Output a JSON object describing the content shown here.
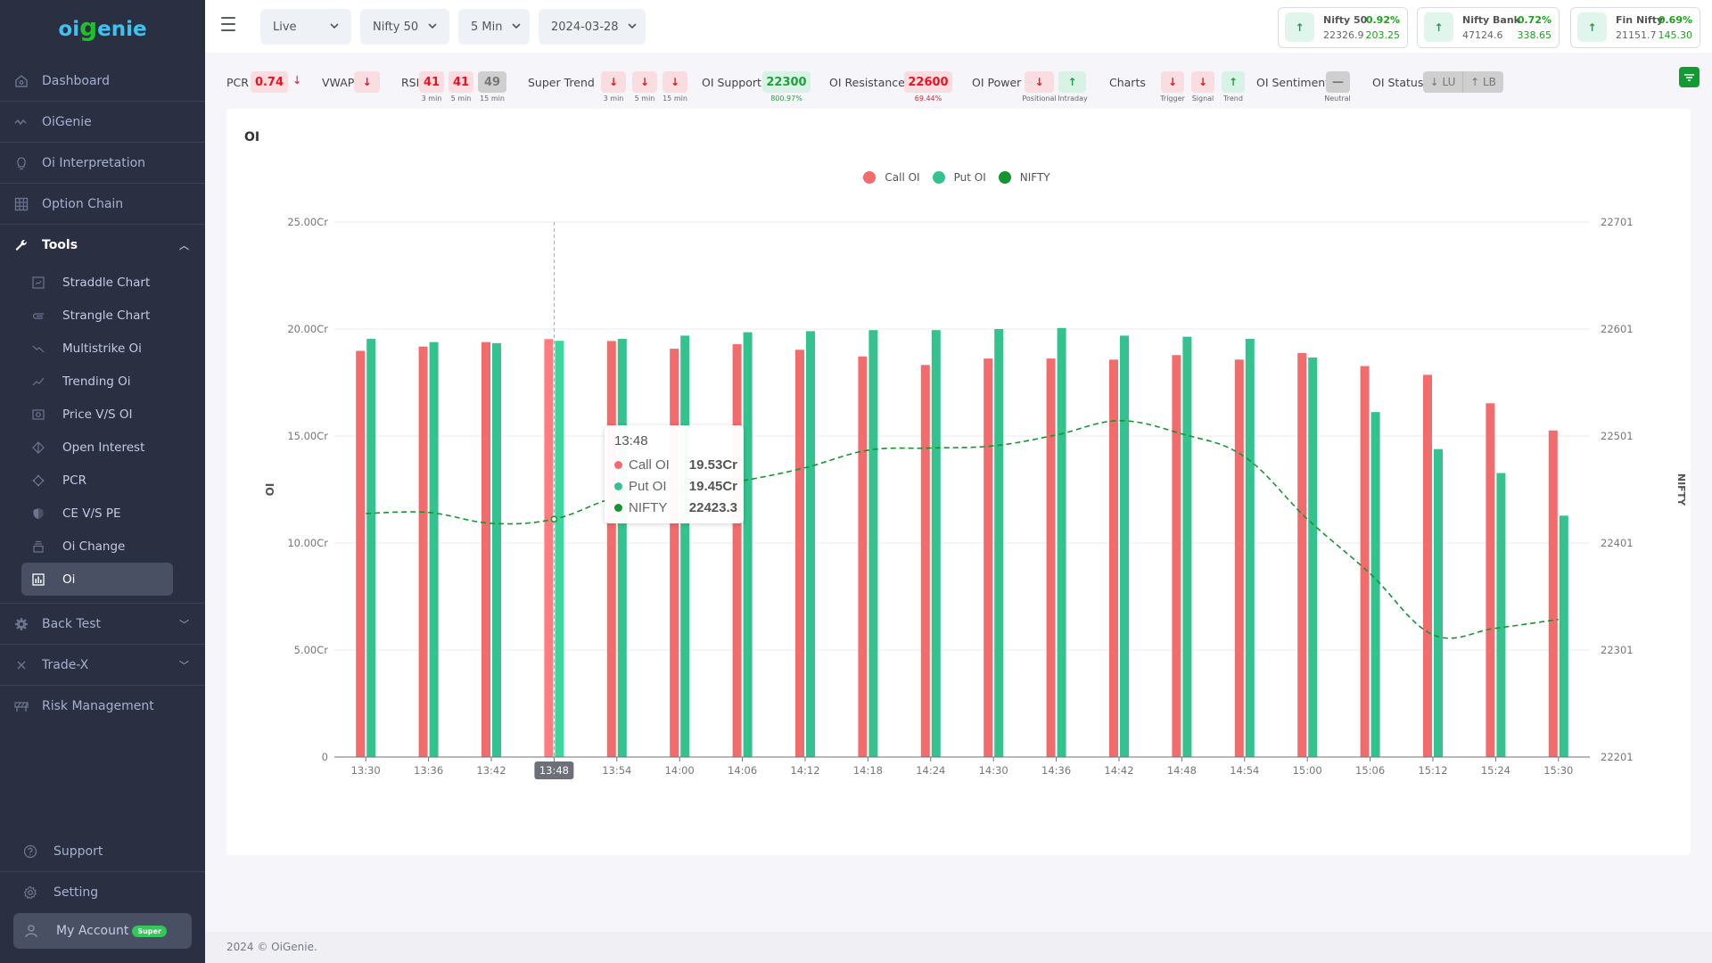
{
  "app": {
    "logo_oi": "oi",
    "logo_g": "g",
    "logo_rest": "enie"
  },
  "sidebar": {
    "items": [
      {
        "label": "Dashboard",
        "icon": "home-icon"
      },
      {
        "label": "OiGenie",
        "icon": "wave-icon"
      },
      {
        "label": "Oi Interpretation",
        "icon": "lightbulb-icon"
      },
      {
        "label": "Option Chain",
        "icon": "grid-icon"
      }
    ],
    "tools": {
      "label": "Tools",
      "expanded": true,
      "sub_items": [
        {
          "label": "Straddle Chart",
          "icon": "chart-box-icon"
        },
        {
          "label": "Strangle Chart",
          "icon": "paperclip-icon"
        },
        {
          "label": "Multistrike Oi",
          "icon": "trend-down-icon"
        },
        {
          "label": "Trending Oi",
          "icon": "trend-up-icon"
        },
        {
          "label": "Price V/S OI",
          "icon": "camera-box-icon"
        },
        {
          "label": "Open Interest",
          "icon": "diamond-icon"
        },
        {
          "label": "PCR",
          "icon": "ring-icon"
        },
        {
          "label": "CE V/S PE",
          "icon": "shield-icon"
        },
        {
          "label": "Oi Change",
          "icon": "layers-icon"
        },
        {
          "label": "Oi",
          "icon": "bar-chart-icon",
          "active": true
        }
      ]
    },
    "after_tools": [
      {
        "label": "Back Test",
        "icon": "gear-icon",
        "has_chevron": true
      },
      {
        "label": "Trade-X",
        "icon": "x-icon",
        "has_chevron": true
      },
      {
        "label": "Risk Management",
        "icon": "barrier-icon"
      }
    ],
    "bottom": [
      {
        "label": "Support",
        "icon": "help-circle-icon"
      },
      {
        "label": "Setting",
        "icon": "settings-icon"
      }
    ],
    "account": {
      "label": "My Account",
      "badge": "Super",
      "icon": "user-icon"
    }
  },
  "topbar": {
    "selects": [
      {
        "name": "mode",
        "value": "Live"
      },
      {
        "name": "index",
        "value": "Nifty 50"
      },
      {
        "name": "interval",
        "value": "5 Min"
      },
      {
        "name": "date",
        "value": "2024-03-28"
      }
    ],
    "tickers": [
      {
        "name": "Nifty 50",
        "price": "22326.9",
        "pct": "0.92%",
        "change": "203.25",
        "direction": "up"
      },
      {
        "name": "Nifty Bank",
        "price": "47124.6",
        "pct": "0.72%",
        "change": "338.65",
        "direction": "up"
      },
      {
        "name": "Fin Nifty",
        "price": "21151.7",
        "pct": "0.69%",
        "change": "145.30",
        "direction": "up"
      }
    ]
  },
  "indicators": {
    "pcr": {
      "label": "PCR",
      "value": "0.74",
      "arrow": "↓"
    },
    "vwap": {
      "label": "VWAP",
      "arrow": "↓"
    },
    "rsi": {
      "label": "RSI",
      "values": [
        "41",
        "41",
        "49"
      ],
      "captions": [
        "3 min",
        "5 min",
        "15 min"
      ]
    },
    "super_trend": {
      "label": "Super Trend",
      "arrows": [
        "↓",
        "↓",
        "↓"
      ],
      "captions": [
        "3 min",
        "5 min",
        "15 min"
      ]
    },
    "oi_support": {
      "label": "OI Support",
      "value": "22300",
      "caption": "800.97%"
    },
    "oi_resistance": {
      "label": "OI Resistance",
      "value": "22600",
      "caption": "69.44%"
    },
    "oi_power": {
      "label": "OI Power",
      "arrows": [
        "↓",
        "↑"
      ],
      "captions": [
        "Positional",
        "Intraday"
      ]
    },
    "charts": {
      "label": "Charts",
      "arrows": [
        "↓",
        "↓",
        "↑"
      ],
      "captions": [
        "Trigger",
        "Signal",
        "Trend"
      ]
    },
    "oi_sentiment": {
      "label": "OI Sentiment",
      "value": "—",
      "caption": "Neutral"
    },
    "oi_status": {
      "label": "OI Status",
      "values": [
        "↓ LU",
        "↑ LB"
      ]
    }
  },
  "card": {
    "title": "OI"
  },
  "tooltip": {
    "time": "13:48",
    "rows": [
      {
        "name": "Call OI",
        "value": "19.53Cr"
      },
      {
        "name": "Put OI",
        "value": "19.45Cr"
      },
      {
        "name": "NIFTY",
        "value": "22423.3"
      }
    ]
  },
  "footer": {
    "text": "2024 © OiGenie."
  },
  "chart_data": {
    "type": "bar",
    "title": "OI",
    "xlabel": "",
    "ylabel": "OI",
    "y2label": "NIFTY",
    "categories": [
      "13:30",
      "13:36",
      "13:42",
      "13:48",
      "13:54",
      "14:00",
      "14:06",
      "14:12",
      "14:18",
      "14:24",
      "14:30",
      "14:36",
      "14:42",
      "14:48",
      "14:54",
      "15:00",
      "15:06",
      "15:12",
      "15:24",
      "15:30"
    ],
    "series": [
      {
        "name": "Call OI",
        "type": "bar",
        "color": "#f26b6d",
        "unit": "Cr",
        "values": [
          18.98,
          19.18,
          19.39,
          19.53,
          19.44,
          19.08,
          19.29,
          19.03,
          18.72,
          18.32,
          18.62,
          18.62,
          18.57,
          18.78,
          18.57,
          18.88,
          18.27,
          17.86,
          16.53,
          15.26
        ]
      },
      {
        "name": "Put OI",
        "type": "bar",
        "color": "#34c38f",
        "unit": "Cr",
        "values": [
          19.54,
          19.39,
          19.34,
          19.45,
          19.54,
          19.69,
          19.85,
          19.9,
          19.95,
          19.95,
          20.0,
          20.05,
          19.69,
          19.64,
          19.54,
          18.67,
          16.12,
          14.39,
          13.27,
          11.28
        ]
      },
      {
        "name": "NIFTY",
        "type": "line",
        "color": "#13962f",
        "axis": "right",
        "dashed": true,
        "values": [
          22428.6,
          22429.6,
          22419.4,
          22423.3,
          22443.9,
          22451.0,
          22459.2,
          22471.4,
          22487.7,
          22489.8,
          22491.8,
          22502.0,
          22515.3,
          22503.0,
          22481.6,
          22423.4,
          22372.4,
          22315.3,
          22321.4,
          22329.6
        ]
      }
    ],
    "ylim": [
      0,
      25
    ],
    "yticks": [
      "0",
      "5.00Cr",
      "10.00Cr",
      "15.00Cr",
      "20.00Cr",
      "25.00Cr"
    ],
    "y2lim": [
      22201,
      22701
    ],
    "y2ticks": [
      "22201",
      "22301",
      "22401",
      "22501",
      "22601",
      "22701"
    ],
    "highlighted_category": "13:48",
    "legend": "top-center",
    "grid": true
  }
}
